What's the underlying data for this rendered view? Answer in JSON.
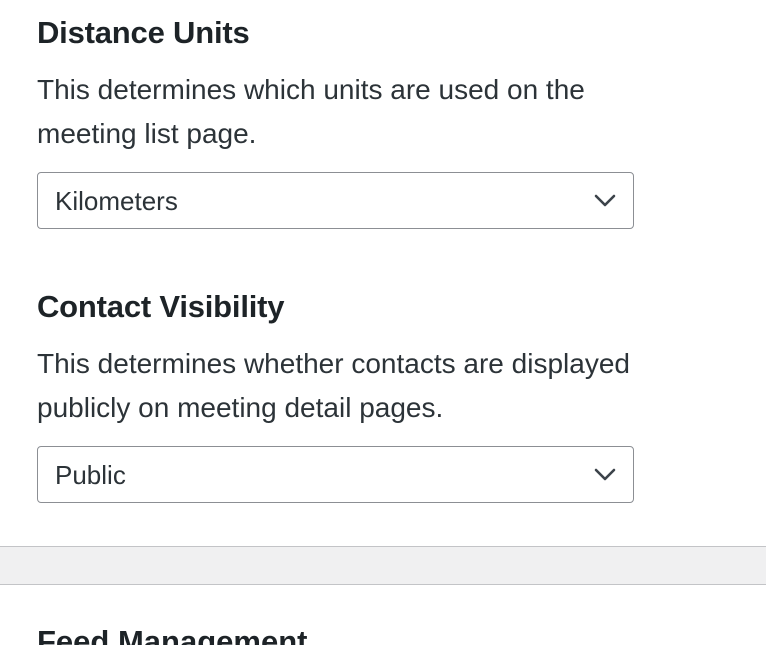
{
  "distance_units": {
    "title": "Distance Units",
    "description_line1": "This determines which units are used on the",
    "description_line2": "meeting list page.",
    "selected": "Kilometers"
  },
  "contact_visibility": {
    "title": "Contact Visibility",
    "description_line1": "This determines whether contacts are displayed",
    "description_line2": "publicly on meeting detail pages.",
    "selected": "Public"
  },
  "next_section": {
    "title": "Feed Management"
  }
}
